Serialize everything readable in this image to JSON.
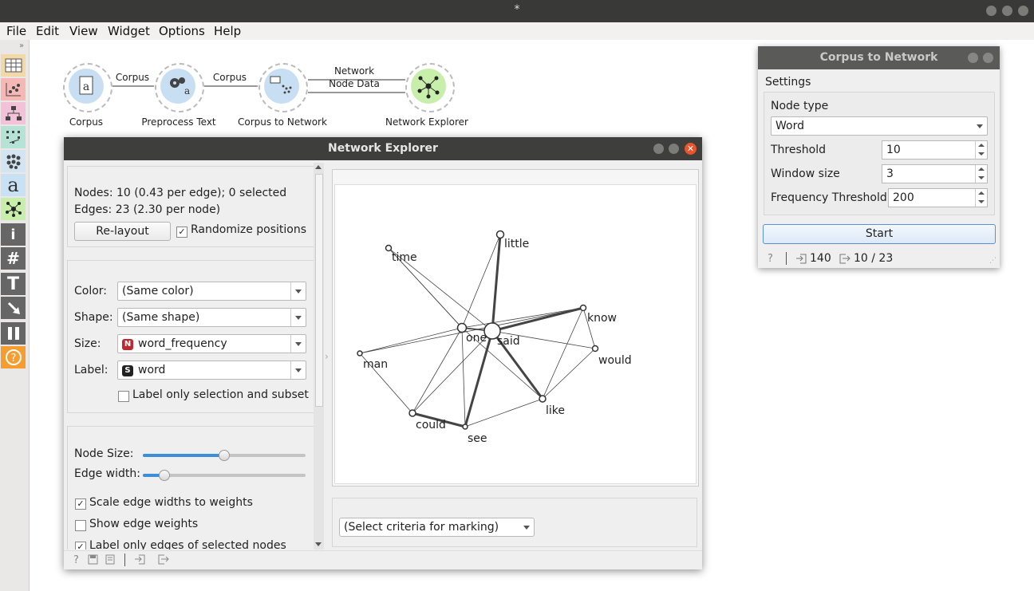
{
  "window": {
    "title": "*"
  },
  "menu": [
    "File",
    "Edit",
    "View",
    "Widget",
    "Options",
    "Help"
  ],
  "toolbar_icons": [
    "data-table-icon",
    "scatter-plot-icon",
    "tree-icon",
    "distance-map-icon",
    "clustering-icon",
    "text-icon",
    "network-icon",
    "info-icon",
    "grid-icon",
    "text-tool-icon",
    "arrow-tool-icon",
    "pause-icon",
    "help-icon"
  ],
  "workflow": {
    "widgets": [
      {
        "name": "Corpus",
        "icon": "corpus-icon"
      },
      {
        "name": "Preprocess Text",
        "icon": "preprocess-icon"
      },
      {
        "name": "Corpus to Network",
        "icon": "corpus-to-network-icon"
      },
      {
        "name": "Network Explorer",
        "icon": "network-explorer-icon"
      }
    ],
    "links": [
      {
        "label": "Corpus"
      },
      {
        "label": "Corpus"
      },
      {
        "label_top": "Network",
        "label_bottom": "Node Data"
      }
    ]
  },
  "explorer": {
    "title": "Network Explorer",
    "info": {
      "nodes": "Nodes: 10 (0.43 per edge); 0 selected",
      "edges": "Edges: 23 (2.30 per node)"
    },
    "relayout_label": "Re-layout",
    "randomize_label": "Randomize positions",
    "randomize_checked": true,
    "color_label": "Color:",
    "color_value": "(Same color)",
    "shape_label": "Shape:",
    "shape_value": "(Same shape)",
    "size_label": "Size:",
    "size_badge": "N",
    "size_value": "word_frequency",
    "label_label": "Label:",
    "label_badge": "S",
    "label_value": "word",
    "label_only_selection": "Label only selection and subset",
    "label_only_selection_checked": false,
    "node_size_label": "Node Size:",
    "node_size_value": 0.5,
    "edge_width_label": "Edge width:",
    "edge_width_value": 0.13,
    "scale_edge_label": "Scale edge widths to weights",
    "scale_edge_checked": true,
    "show_weights_label": "Show edge weights",
    "show_weights_checked": false,
    "label_edges_label": "Label only edges of selected nodes",
    "label_edges_checked": true,
    "marking_value": "(Select criteria for marking)"
  },
  "network": {
    "nodes": [
      "little",
      "time",
      "know",
      "one",
      "said",
      "would",
      "man",
      "like",
      "could",
      "see"
    ],
    "edges": [
      [
        "said",
        "little",
        3
      ],
      [
        "said",
        "know",
        4
      ],
      [
        "said",
        "see",
        3
      ],
      [
        "said",
        "like",
        3
      ],
      [
        "said",
        "would",
        1
      ],
      [
        "said",
        "one",
        2
      ],
      [
        "said",
        "time",
        1
      ],
      [
        "said",
        "could",
        1
      ],
      [
        "one",
        "little",
        1
      ],
      [
        "one",
        "know",
        1
      ],
      [
        "one",
        "man",
        1
      ],
      [
        "one",
        "could",
        1
      ],
      [
        "one",
        "see",
        1
      ],
      [
        "one",
        "time",
        1
      ],
      [
        "one",
        "like",
        1
      ],
      [
        "could",
        "see",
        3
      ],
      [
        "could",
        "man",
        1
      ],
      [
        "see",
        "like",
        1
      ],
      [
        "like",
        "would",
        1
      ],
      [
        "like",
        "know",
        1
      ],
      [
        "man",
        "know",
        1
      ],
      [
        "time",
        "one",
        1
      ],
      [
        "know",
        "would",
        1
      ]
    ]
  },
  "ctn": {
    "title": "Corpus to Network",
    "settings_label": "Settings",
    "node_type_label": "Node type",
    "node_type_value": "Word",
    "threshold_label": "Threshold",
    "threshold_value": "10",
    "window_size_label": "Window size",
    "window_size_value": "3",
    "freq_label": "Frequency Threshold",
    "freq_value": "200",
    "start_label": "Start",
    "status_in": "140",
    "status_out": "10 / 23"
  }
}
